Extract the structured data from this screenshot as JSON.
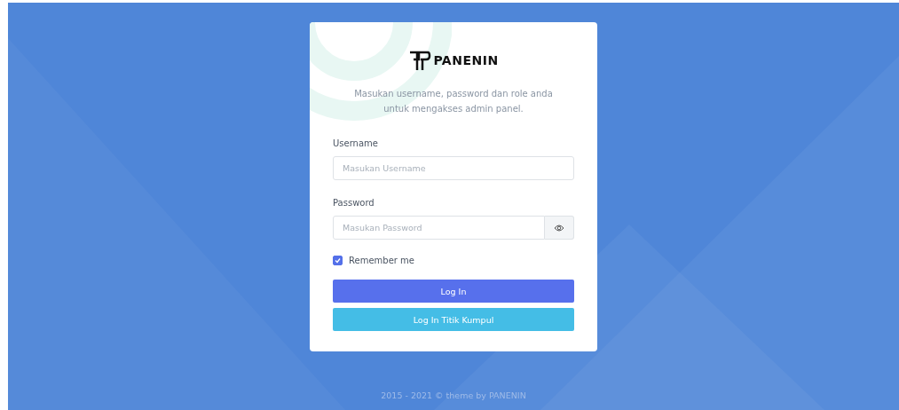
{
  "logo": {
    "text": "PANENIN"
  },
  "intro": "Masukan username, password dan role anda untuk mengakses admin panel.",
  "fields": [
    {
      "kind": "text",
      "label": "Username",
      "placeholder": "Masukan Username"
    },
    {
      "kind": "password",
      "label": "Password",
      "placeholder": "Masukan Password"
    }
  ],
  "remember": {
    "label": "Remember me",
    "checked": true
  },
  "buttons": [
    {
      "label": "Log In",
      "kind": "primary"
    },
    {
      "label": "Log In Titik Kumpul",
      "kind": "info"
    }
  ],
  "footer": "2015 - 2021 © theme by PANENIN"
}
